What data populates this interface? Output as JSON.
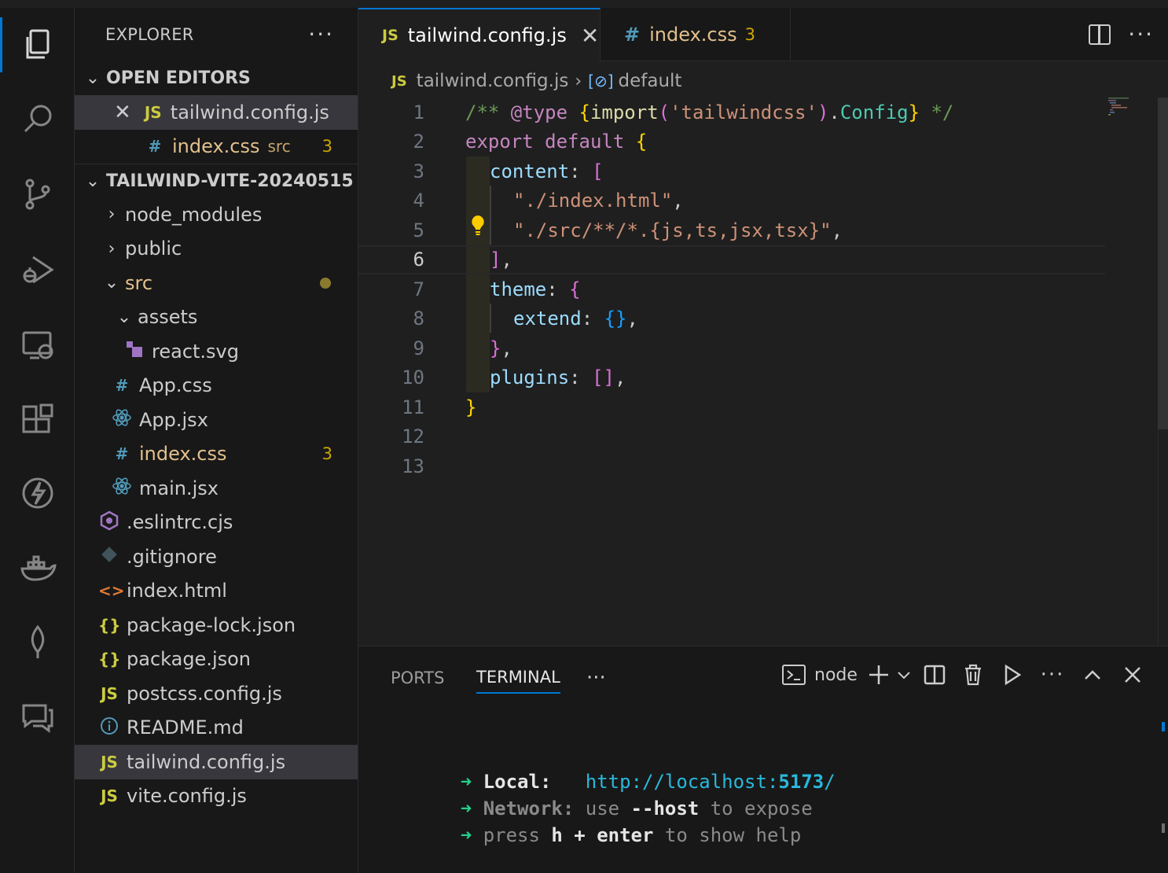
{
  "explorer": {
    "title": "EXPLORER",
    "more": "···",
    "open_editors_label": "OPEN EDITORS",
    "open_editors": [
      {
        "icon": "JS",
        "name": "tailwind.config.js",
        "close": "✕"
      },
      {
        "icon": "#",
        "name": "index.css",
        "desc": "src",
        "badge": "3"
      }
    ],
    "project_label": "TAILWIND-VITE-20240515",
    "tree": [
      {
        "chev": "›",
        "name": "node_modules"
      },
      {
        "chev": "›",
        "name": "public"
      },
      {
        "chev": "⌄",
        "name": "src"
      },
      {
        "chev": "⌄",
        "name": "assets"
      },
      {
        "name": "react.svg"
      },
      {
        "icon": "#",
        "name": "App.css"
      },
      {
        "name": "App.jsx"
      },
      {
        "icon": "#",
        "name": "index.css",
        "badge": "3"
      },
      {
        "name": "main.jsx"
      },
      {
        "name": ".eslintrc.cjs"
      },
      {
        "name": ".gitignore"
      },
      {
        "icon": "<>",
        "name": "index.html"
      },
      {
        "icon": "{}",
        "name": "package-lock.json"
      },
      {
        "icon": "{}",
        "name": "package.json"
      },
      {
        "icon": "JS",
        "name": "postcss.config.js"
      },
      {
        "icon": "i",
        "name": "README.md"
      },
      {
        "icon": "JS",
        "name": "tailwind.config.js"
      },
      {
        "icon": "JS",
        "name": "vite.config.js"
      }
    ]
  },
  "tabs": [
    {
      "icon": "JS",
      "label": "tailwind.config.js",
      "close": "✕"
    },
    {
      "icon": "#",
      "label": "index.css",
      "badge": "3"
    }
  ],
  "breadcrumb": {
    "icon": "JS",
    "file": "tailwind.config.js",
    "sep": "›",
    "symbol_icon": "[⊘]",
    "symbol": "default"
  },
  "editor": {
    "line_numbers": [
      "1",
      "2",
      "3",
      "4",
      "5",
      "6",
      "7",
      "8",
      "9",
      "10",
      "11",
      "12",
      "13"
    ],
    "current_line": "6",
    "code": {
      "l1a": "/** ",
      "l1b": "@type",
      "l1c": " ",
      "l1d": "{",
      "l1e": "import",
      "l1f": "(",
      "l1g": "'tailwindcss'",
      "l1h": ")",
      "l1i": ".",
      "l1j": "Config",
      "l1k": "}",
      "l1l": " */",
      "l2a": "export",
      "l2b": " ",
      "l2c": "default",
      "l2d": " ",
      "l2e": "{",
      "l3a": "content",
      "l3b": ": ",
      "l3c": "[",
      "l4a": "\"./index.html\"",
      "l4b": ",",
      "l5a": "\"./src/**/*.{js,ts,jsx,tsx}\"",
      "l5b": ",",
      "l6a": "]",
      "l6b": ",",
      "l7a": "theme",
      "l7b": ": ",
      "l7c": "{",
      "l8a": "extend",
      "l8b": ": ",
      "l8c": "{}",
      "l8d": ",",
      "l9a": "}",
      "l9b": ",",
      "l10a": "plugins",
      "l10b": ": ",
      "l10c": "[]",
      "l10d": ",",
      "l11a": "}"
    }
  },
  "panel": {
    "tabs": [
      "PORTS",
      "TERMINAL"
    ],
    "more": "···",
    "terminal_name": "node",
    "lines": {
      "arrow": "➜",
      "local_label": "Local:",
      "local_url_a": "http://localhost:",
      "local_url_port": "5173",
      "local_url_b": "/",
      "network_label": "Network:",
      "network_a": " use ",
      "network_b": "--host",
      "network_c": " to expose",
      "help_a": "press ",
      "help_b": "h + enter",
      "help_c": " to show help"
    }
  },
  "colors": {
    "accent": "#0078d4",
    "modified": "#e2c08d",
    "js": "#cbcb41",
    "css": "#519aba"
  }
}
